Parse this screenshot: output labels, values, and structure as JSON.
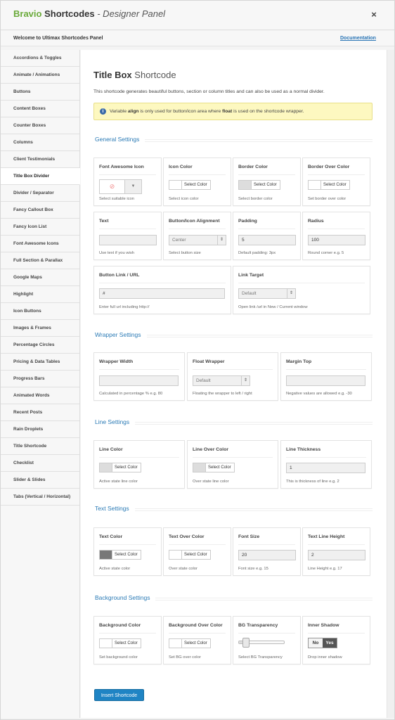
{
  "header": {
    "brand_green": "Bravio",
    "brand_bold": "Shortcodes",
    "brand_rest": "- Designer Panel",
    "close": "×"
  },
  "subheader": {
    "welcome": "Welcome to Ultimax Shortcodes Panel",
    "documentation": "Documentation"
  },
  "sidebar": {
    "items": [
      "Accordions & Toggles",
      "Animate / Animations",
      "Buttons",
      "Content Boxes",
      "Counter Boxes",
      "Columns",
      "Client Testimonials",
      "Title Box Divider",
      "Divider / Separator",
      "Fancy Callout Box",
      "Fancy Icon List",
      "Font Awesome Icons",
      "Full Section & Parallax",
      "Google Maps",
      "Highlight",
      "Icon Buttons",
      "Images & Frames",
      "Percentage Circles",
      "Pricing & Data Tables",
      "Progress Bars",
      "Animated Words",
      "Recent Posts",
      "Rain Droplets",
      "Title Shortcode",
      "Checklist",
      "Slider & Slides",
      "Tabs (Vertical / Horizontal)"
    ],
    "active_index": 7
  },
  "page": {
    "title_bold": "Title Box",
    "title_light": "Shortcode",
    "description": "This shortcode generates beautiful buttons, section or column titles and can also be used as a normal divider.",
    "info_pre": "Variable ",
    "info_b1": "align",
    "info_mid": " is only used for button/icon area where ",
    "info_b2": "float",
    "info_post": " is used on the shortcode wrapper."
  },
  "sections": {
    "general": "General Settings",
    "wrapper": "Wrapper Settings",
    "line": "Line Settings",
    "text": "Text Settings",
    "background": "Background Settings"
  },
  "general": {
    "font_awesome_icon": {
      "label": "Font Awesome Icon",
      "hint": "Select suitable icon",
      "icon": "ban-icon",
      "caret": "▼"
    },
    "icon_color": {
      "label": "Icon Color",
      "button": "Select Color",
      "hint": "Select icon color",
      "swatch": "#ffffff"
    },
    "border_color": {
      "label": "Border Color",
      "button": "Select Color",
      "hint": "Select border color",
      "swatch": "#dddddd"
    },
    "border_over_color": {
      "label": "Border Over Color",
      "button": "Select Color",
      "hint": "Set border over color",
      "swatch": "#ffffff"
    },
    "text": {
      "label": "Text",
      "value": "",
      "hint": "Use text if you wish"
    },
    "button_icon_alignment": {
      "label": "Button/Icon Alignment",
      "value": "Center",
      "hint": "Select button size",
      "arrow": "⇕"
    },
    "padding": {
      "label": "Padding",
      "value": "5",
      "hint": "Default padding: 3px"
    },
    "radius": {
      "label": "Radius",
      "value": "100",
      "hint": "Round corner e.g. 5"
    },
    "button_link": {
      "label": "Button Link / URL",
      "value": "#",
      "hint": "Enter full url including http://"
    },
    "link_target": {
      "label": "Link Target",
      "value": "Default",
      "hint": "Open link /url in New / Current window",
      "arrow": "⇕"
    }
  },
  "wrapper": {
    "wrapper_width": {
      "label": "Wrapper Width",
      "value": "",
      "hint": "Calculated in percentage % e.g. 80"
    },
    "float_wrapper": {
      "label": "Float Wrapper",
      "value": "Default",
      "hint": "Floating the wrapper to left / right",
      "arrow": "⇕"
    },
    "margin_top": {
      "label": "Margin Top",
      "value": "",
      "hint": "Negative values are allowed e.g. -30"
    }
  },
  "line": {
    "line_color": {
      "label": "Line Color",
      "button": "Select Color",
      "hint": "Active state line color",
      "swatch": "#dddddd"
    },
    "line_over_color": {
      "label": "Line Over Color",
      "button": "Select Color",
      "hint": "Over state line color",
      "swatch": "#dddddd"
    },
    "line_thickness": {
      "label": "Line Thickness",
      "value": "1",
      "hint": "This is thickness of line e.g. 2"
    }
  },
  "text": {
    "text_color": {
      "label": "Text Color",
      "button": "Select Color",
      "hint": "Active state color",
      "swatch": "#777777"
    },
    "text_over_color": {
      "label": "Text Over Color",
      "button": "Select Color",
      "hint": "Over state color",
      "swatch": "#ffffff"
    },
    "font_size": {
      "label": "Font Size",
      "value": "20",
      "hint": "Font size e.g. 15"
    },
    "text_line_height": {
      "label": "Text Line Height",
      "value": "2",
      "hint": "Line Height e.g. 17"
    }
  },
  "background": {
    "background_color": {
      "label": "Background Color",
      "button": "Select Color",
      "hint": "Set background color",
      "swatch": "#ffffff"
    },
    "background_over_color": {
      "label": "Background Over Color",
      "button": "Select Color",
      "hint": "Set BG over color",
      "swatch": "#ffffff"
    },
    "bg_transparency": {
      "label": "BG Transparency",
      "hint": "Select BG Transparency",
      "value": 0.1
    },
    "inner_shadow": {
      "label": "Inner Shadow",
      "no": "No",
      "yes": "Yes",
      "selected": "Yes",
      "hint": "Drop inner shadow"
    }
  },
  "insert_button": "Insert Shortcode",
  "colors": {
    "accent": "#1f84c4",
    "brand_green": "#6aaa3a",
    "info_bg": "#fdf8c0"
  }
}
